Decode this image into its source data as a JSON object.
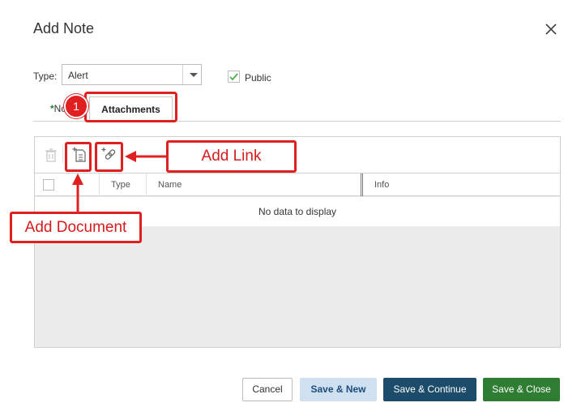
{
  "dialog": {
    "title": "Add Note",
    "close_icon": "close-icon"
  },
  "form": {
    "type_label": "Type:",
    "type_value": "Alert",
    "public_label": "Public",
    "public_checked": true
  },
  "tabs": {
    "notes_asterisk": "*",
    "notes_label": "Notes",
    "attachments_label": "Attachments"
  },
  "toolbar": {
    "delete_icon": "trash-icon",
    "add_document_icon": "add-document-icon",
    "add_link_icon": "add-link-icon"
  },
  "grid": {
    "columns": [
      "",
      "Type",
      "Name",
      "Info"
    ],
    "empty_text": "No data to display"
  },
  "annotations": {
    "step_number": "1",
    "add_link": "Add Link",
    "add_document": "Add Document",
    "highlight_color": "#e02020"
  },
  "footer": {
    "cancel": "Cancel",
    "save_new": "Save & New",
    "save_continue": "Save & Continue",
    "save_close": "Save & Close"
  },
  "colors": {
    "save_continue": "#1d4c6b",
    "save_close": "#2e7d32",
    "save_new": "#cfe0f1",
    "required": "#2e7d32"
  }
}
